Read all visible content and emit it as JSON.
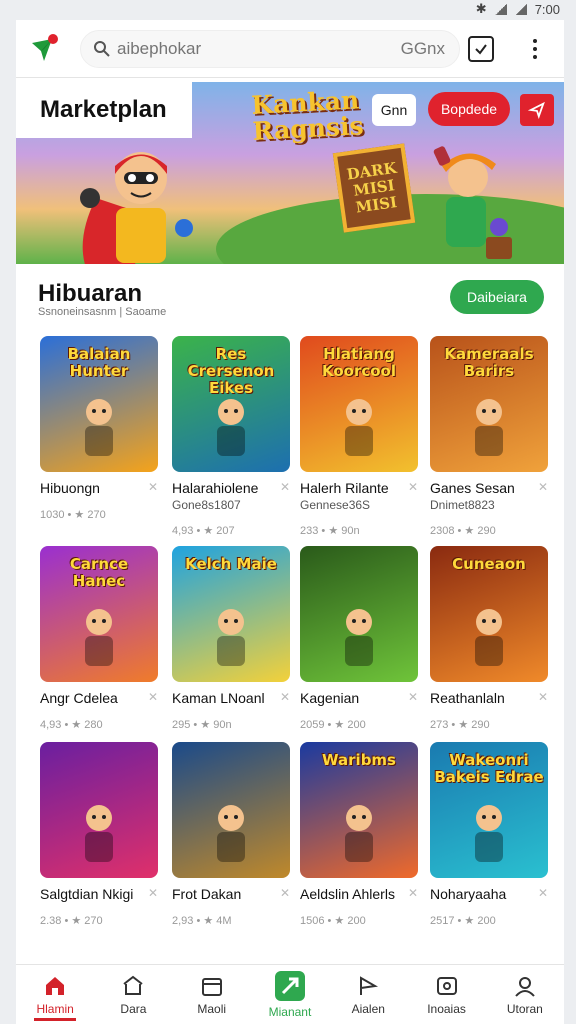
{
  "status": {
    "time": "7:00"
  },
  "topbar": {
    "search_placeholder": "aibephokar",
    "search_code": "GGnx"
  },
  "banner": {
    "title": "Marketplan",
    "promo_line1": "Kankan",
    "promo_line2": "Ragnsis",
    "btn_white": "Gnn",
    "btn_red": "Bopdede",
    "sign_line1": "DARK",
    "sign_line2": "MISI",
    "sign_line3": "MISI"
  },
  "section": {
    "title": "Hibuaran",
    "subtitle": "Ssnoneinsasnm | Saoame",
    "more_label": "Daibeiara"
  },
  "games": [
    {
      "art": "Balaian Hunter",
      "name": "Hibuongn",
      "stats": "1030 • ★ 270",
      "colors": [
        "#2b6fd8",
        "#f5a31a"
      ]
    },
    {
      "art": "Res Crersenon Eikes",
      "name": "Halarahiolene",
      "sub": "Gone8s1807",
      "stats": "4,93 • ★ 207",
      "colors": [
        "#3bb34a",
        "#1d6fb0"
      ]
    },
    {
      "art": "Hlatiang Koorcool",
      "name": "Halerh Rilante",
      "sub": "Gennese36S",
      "stats": "233 • ★ 90n",
      "colors": [
        "#e04a1d",
        "#f2c12e"
      ]
    },
    {
      "art": "Kameraals Barirs",
      "name": "Ganes Sesan",
      "sub": "Dnimet8823",
      "stats": "2308 • ★ 290",
      "colors": [
        "#b8521a",
        "#f0a23b"
      ]
    },
    {
      "art": "Carnce Hanec",
      "name": "Angr Cdelea",
      "stats": "4,93 • ★ 280",
      "colors": [
        "#9a2fd0",
        "#f07c2a"
      ]
    },
    {
      "art": "Kelch Maie",
      "name": "Kaman LNoanl",
      "stats": "295 • ★ 90n",
      "colors": [
        "#1fa3e0",
        "#f3d13a"
      ]
    },
    {
      "art": "",
      "name": "Kagenian",
      "stats": "2059 • ★ 200",
      "colors": [
        "#2a5a1a",
        "#6fc43a"
      ]
    },
    {
      "art": "Cuneaon",
      "name": "Reathanlaln",
      "stats": "273 • ★ 290",
      "colors": [
        "#8a2a10",
        "#f08a2a"
      ]
    },
    {
      "art": "",
      "name": "Salgtdian Nkigi",
      "stats": "2.38 • ★ 270",
      "colors": [
        "#6a1fa0",
        "#e0306a"
      ]
    },
    {
      "art": "",
      "name": "Frot Dakan",
      "stats": "2,93 • ★ 4M",
      "colors": [
        "#1a4a8a",
        "#c0892a"
      ]
    },
    {
      "art": "Waribms",
      "name": "Aeldslin Ahlerls",
      "stats": "1506 • ★ 200",
      "colors": [
        "#1a3aa0",
        "#f06a2a"
      ]
    },
    {
      "art": "Wakeonri Bakeis Edrae",
      "name": "Noharyaaha",
      "stats": "2517 • ★ 200",
      "colors": [
        "#1a7ab0",
        "#2ac0d0"
      ]
    }
  ],
  "nav": [
    {
      "label": "Hlamin",
      "icon": "home-icon"
    },
    {
      "label": "Dara",
      "icon": "store-icon"
    },
    {
      "label": "Maoli",
      "icon": "calendar-icon"
    },
    {
      "label": "Mianant",
      "icon": "play-icon"
    },
    {
      "label": "Aialen",
      "icon": "flag-icon"
    },
    {
      "label": "Inoaias",
      "icon": "gamepad-icon"
    },
    {
      "label": "Utoran",
      "icon": "profile-icon"
    }
  ],
  "colors": {
    "accent_red": "#d3222a",
    "accent_green": "#2fa84f"
  }
}
